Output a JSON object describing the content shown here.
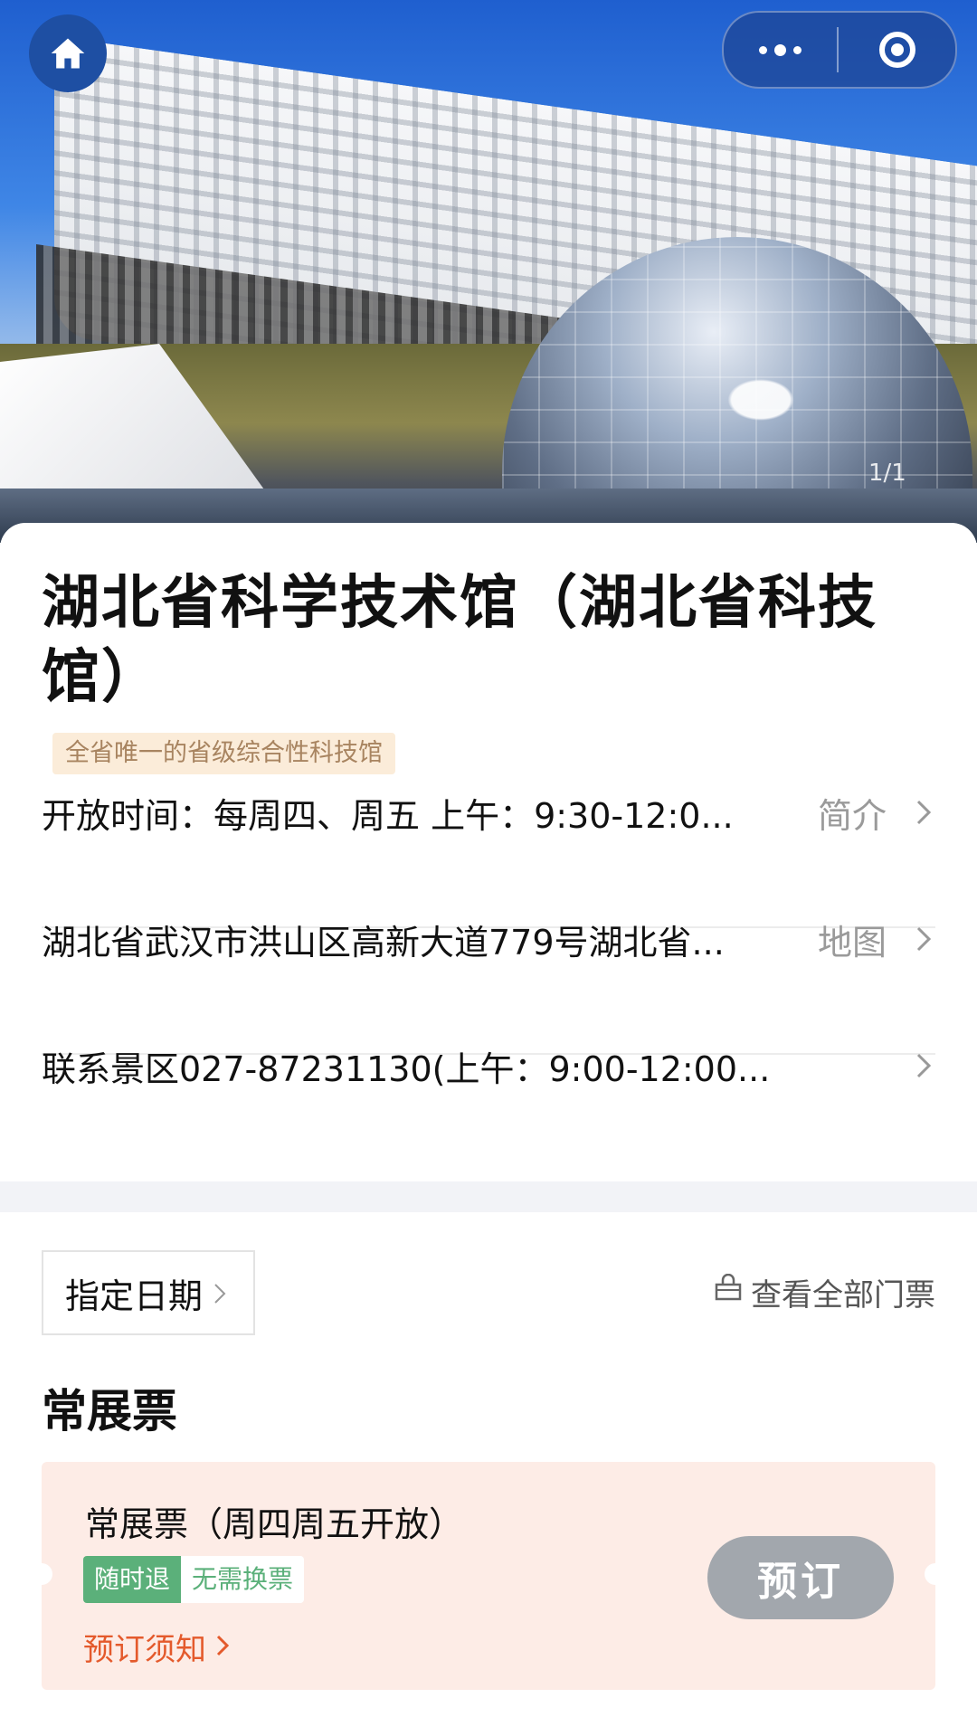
{
  "hero": {
    "pager": "1/1"
  },
  "nav": {
    "home_icon": "home-icon",
    "more_icon": "more-dots-icon",
    "close_icon": "target-close-icon"
  },
  "venue": {
    "title": "湖北省科学技术馆（湖北省科技馆）",
    "tag": "全省唯一的省级综合性科技馆",
    "hours_text": "开放时间：每周四、周五 上午：9:30-12:0...",
    "hours_link": "简介",
    "address_text": "湖北省武汉市洪山区高新大道779号湖北省...",
    "address_link": "地图",
    "contact_text": "联系景区027-87231130(上午：9:00-12:00..."
  },
  "tickets": {
    "date_button": "指定日期",
    "view_all": "查看全部门票",
    "section_title": "常展票",
    "items": [
      {
        "name": "常展票（周四周五开放）",
        "badge_primary": "随时退",
        "badge_secondary": "无需换票",
        "notice": "预订须知",
        "book_label": "预订"
      }
    ]
  },
  "colors": {
    "accent_orange": "#e45a2c",
    "badge_green": "#5bb07a",
    "ticket_bg": "#fdece6",
    "tag_bg": "#fbecd9",
    "book_disabled": "#a2a7ad"
  }
}
